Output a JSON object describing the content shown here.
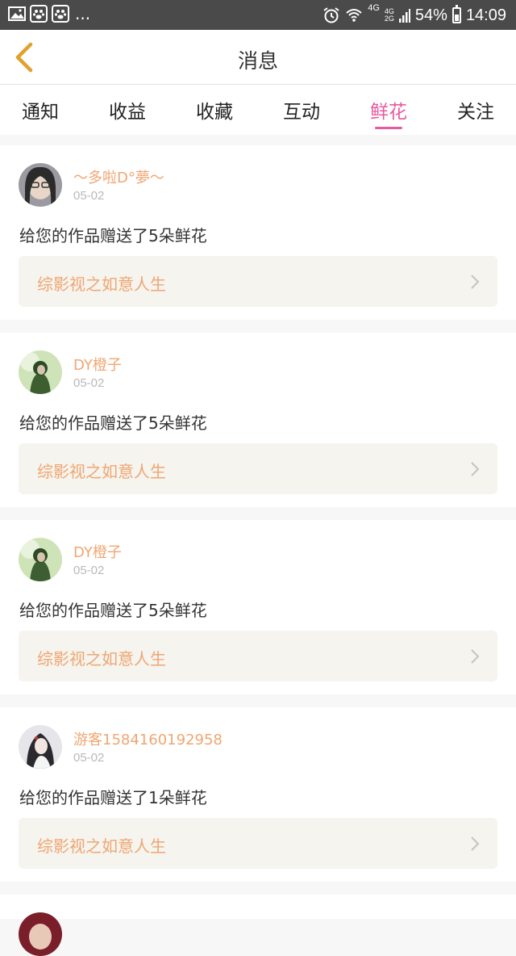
{
  "status_bar": {
    "overflow": "...",
    "net_top": "4G",
    "net_mid": "4G",
    "net_bottom": "2G",
    "battery": "54%",
    "time": "14:09",
    "battery_level": 0.54
  },
  "header": {
    "title": "消息"
  },
  "tabs": [
    {
      "label": "通知"
    },
    {
      "label": "收益"
    },
    {
      "label": "收藏"
    },
    {
      "label": "互动"
    },
    {
      "label": "鲜花",
      "active": true
    },
    {
      "label": "关注"
    }
  ],
  "messages": [
    {
      "username": "～多啦D°夢～",
      "date": "05-02",
      "text": "给您的作品赠送了5朵鲜花",
      "work": "综影视之如意人生",
      "avatar_color": "#3a3a3a"
    },
    {
      "username": "DY橙子",
      "date": "05-02",
      "text": "给您的作品赠送了5朵鲜花",
      "work": "综影视之如意人生",
      "avatar_color": "#4f7a3e"
    },
    {
      "username": "DY橙子",
      "date": "05-02",
      "text": "给您的作品赠送了5朵鲜花",
      "work": "综影视之如意人生",
      "avatar_color": "#4f7a3e"
    },
    {
      "username": "游客1584160192958",
      "date": "05-02",
      "text": "给您的作品赠送了1朵鲜花",
      "work": "综影视之如意人生",
      "avatar_color": "#c9c9cc"
    }
  ],
  "colors": {
    "accent": "#e85a9f",
    "username": "#f0a672",
    "card_bg": "#f5f4ee"
  }
}
